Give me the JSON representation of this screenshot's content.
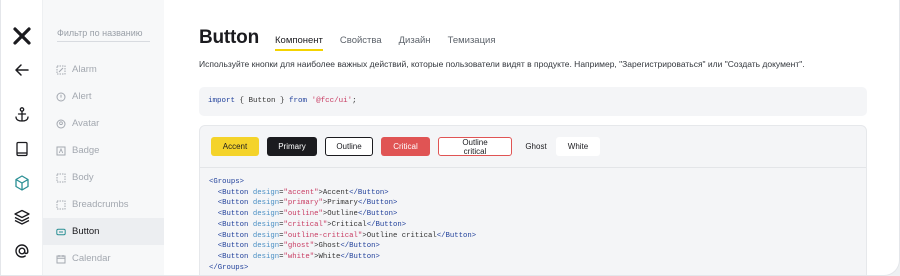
{
  "rail": {
    "icons": [
      "logo-x-icon",
      "back-arrow-icon",
      "anchor-icon",
      "book-icon",
      "cube-icon",
      "layers-icon",
      "at-sign-icon"
    ]
  },
  "sidebar": {
    "filter_placeholder": "Фильтр по названию",
    "items": [
      {
        "label": "Alarm",
        "icon": "alarm-icon"
      },
      {
        "label": "Alert",
        "icon": "alert-icon"
      },
      {
        "label": "Avatar",
        "icon": "avatar-icon"
      },
      {
        "label": "Badge",
        "icon": "badge-icon"
      },
      {
        "label": "Body",
        "icon": "body-icon"
      },
      {
        "label": "Breadcrumbs",
        "icon": "breadcrumbs-icon"
      },
      {
        "label": "Button",
        "icon": "button-icon",
        "active": true
      },
      {
        "label": "Calendar",
        "icon": "calendar-icon"
      }
    ]
  },
  "main": {
    "title": "Button",
    "tabs": [
      {
        "label": "Компонент",
        "active": true
      },
      {
        "label": "Свойства"
      },
      {
        "label": "Дизайн"
      },
      {
        "label": "Темизация"
      }
    ],
    "description": "Используйте кнопки для наиболее важных действий, которые пользователи видят в продукте. Например, \"Зарегистрироваться\" или \"Создать документ\".",
    "import_code": {
      "kw1": "import",
      "mid": " { Button } ",
      "kw2": "from",
      "str": "'@fcc/ui'",
      "end": ";"
    },
    "buttons": [
      {
        "label": "Accent",
        "design": "accent"
      },
      {
        "label": "Primary",
        "design": "primary"
      },
      {
        "label": "Outline",
        "design": "outline"
      },
      {
        "label": "Critical",
        "design": "critical"
      },
      {
        "label": "Outline critical",
        "design": "outline-critical"
      },
      {
        "label": "Ghost",
        "design": "ghost"
      },
      {
        "label": "White",
        "design": "white"
      }
    ],
    "code_lines": {
      "open": "<Groups>",
      "close": "</Groups>",
      "tag_open": "<Button",
      "attr": "design",
      "tag_close": "</Button>",
      "rows": [
        {
          "value": "\"accent\"",
          "text": "Accent"
        },
        {
          "value": "\"primary\"",
          "text": "Primary"
        },
        {
          "value": "\"outline\"",
          "text": "Outline"
        },
        {
          "value": "\"critical\"",
          "text": "Critical"
        },
        {
          "value": "\"outline-critical\"",
          "text": "Outline critical"
        },
        {
          "value": "\"ghost\"",
          "text": "Ghost"
        },
        {
          "value": "\"white\"",
          "text": "White"
        }
      ]
    }
  },
  "colors": {
    "accent": "#f4d32a",
    "primary": "#1b1b1f",
    "critical": "#e05454",
    "tab_underline": "#f4d300"
  }
}
